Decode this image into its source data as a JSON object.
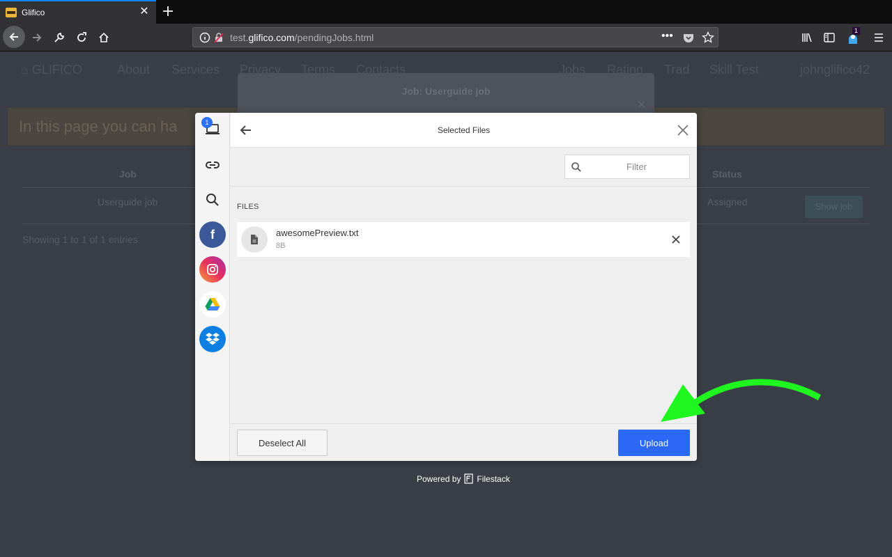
{
  "browser": {
    "tab_title": "Glifico",
    "url_prefix": "test.",
    "url_domain": "glifico.com",
    "url_path": "/pendingJobs.html",
    "extension_badge": "1"
  },
  "site": {
    "brand": "GLIFICO",
    "nav_left": [
      "About",
      "Services",
      "Privacy",
      "Terms",
      "Contacts"
    ],
    "nav_right": [
      "Jobs",
      "Rating",
      "Trad",
      "Skill Test",
      "johnglifico42"
    ],
    "info_text": "In this page you can ha",
    "table_headers": {
      "job": "Job",
      "status": "Status"
    },
    "row": {
      "job": "Userguide job",
      "status": "Assigned",
      "action": "Show job"
    },
    "showing": "Showing 1 to 1 of 1 entries",
    "modal_title": "Job: Userguide job"
  },
  "picker": {
    "title": "Selected Files",
    "filter_placeholder": "Filter",
    "files_label": "FILES",
    "files": [
      {
        "name": "awesomePreview.txt",
        "size": "8B"
      }
    ],
    "sources": [
      "computer-icon",
      "link-icon",
      "search-icon",
      "facebook-icon",
      "instagram-icon",
      "google-drive-icon",
      "dropbox-icon"
    ],
    "computer_badge": "1",
    "deselect_label": "Deselect All",
    "upload_label": "Upload"
  },
  "footer": {
    "powered_by": "Powered by",
    "brand": "Filestack"
  },
  "colors": {
    "accent": "#2b68f5",
    "annotation_arrow": "#1ff51f",
    "overlay_bg": "#3a3f47"
  }
}
